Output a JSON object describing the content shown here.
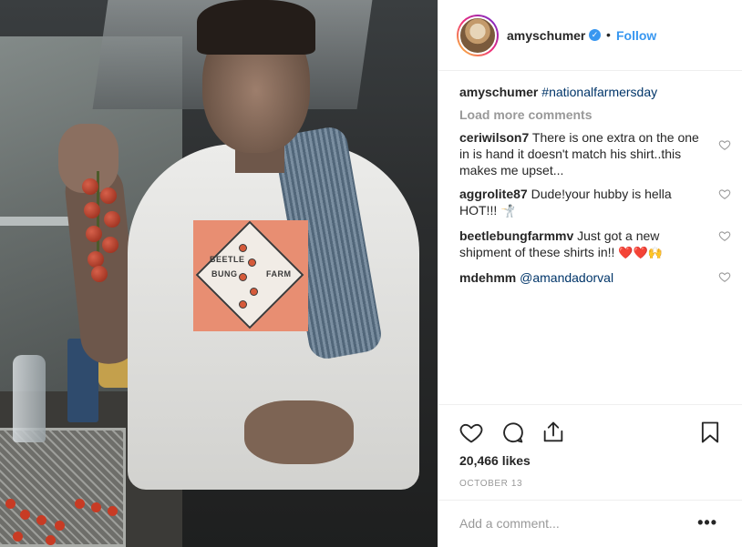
{
  "post": {
    "author": "amyschumer",
    "follow_label": "Follow",
    "separator": "•",
    "verified_mark": "✓",
    "caption": {
      "username": "amyschumer",
      "hashtag": "#nationalfarmersday"
    },
    "load_more_label": "Load more comments",
    "photo_shirt_text": [
      "BEETLE",
      "BUNG",
      "FARM"
    ],
    "comments": [
      {
        "username": "ceriwilson7",
        "text": "There is one extra on the one in is hand it doesn't match his shirt..this makes me upset..."
      },
      {
        "username": "aggrolite87",
        "text": "Dude!your hubby is hella HOT!!!",
        "emoji": "🤺"
      },
      {
        "username": "beetlebungfarmmv",
        "text": "Just got a new shipment of these shirts in!!",
        "emoji": [
          "❤️",
          "❤️",
          "🙌"
        ]
      },
      {
        "username": "mdehmm",
        "mention": "@amandadorval"
      }
    ],
    "likes": "20,466 likes",
    "date": "OCTOBER 13",
    "add_comment_placeholder": "Add a comment...",
    "more_label": "•••"
  },
  "icons": {
    "like": "heart-icon",
    "comment": "comment-bubble-icon",
    "share": "share-icon",
    "save": "bookmark-icon",
    "comment_like": "small-heart-icon"
  },
  "colors": {
    "accent": "#3897f0",
    "text": "#262626",
    "muted": "#999999",
    "link": "#003569"
  }
}
